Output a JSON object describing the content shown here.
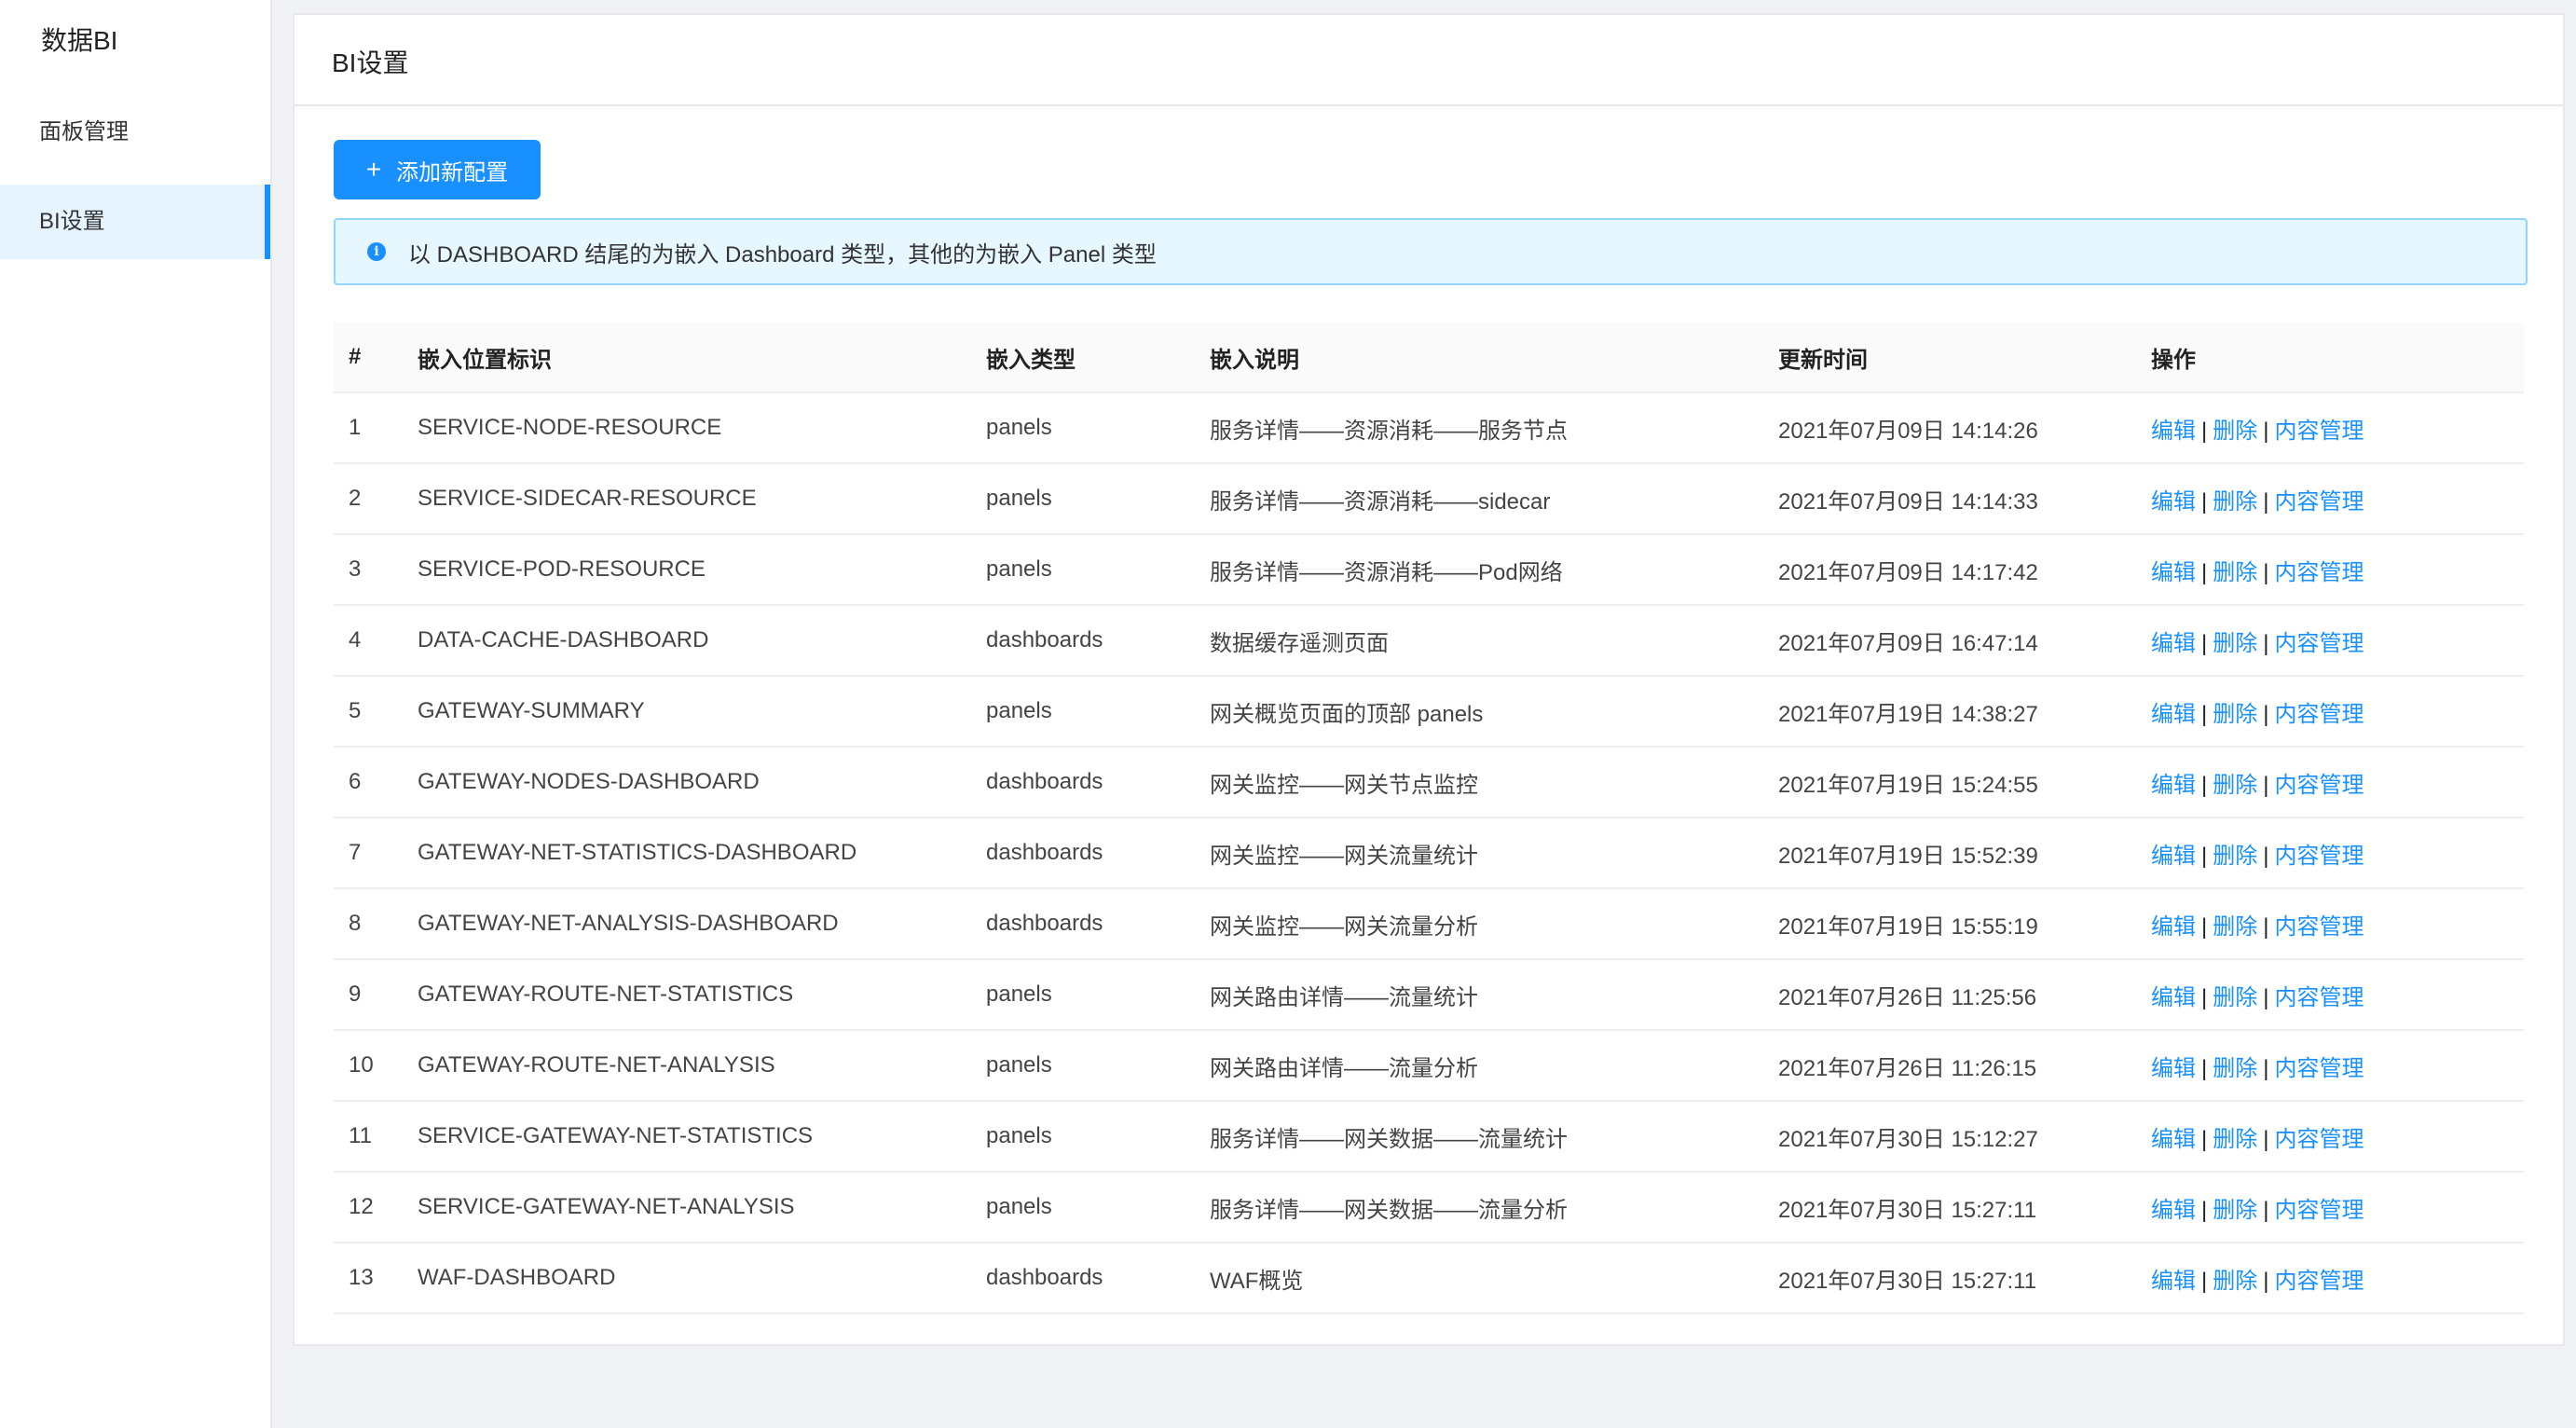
{
  "sidebar": {
    "title": "数据BI",
    "items": [
      {
        "label": "面板管理"
      },
      {
        "label": "BI设置"
      }
    ]
  },
  "page": {
    "title": "BI设置",
    "add_button_label": "添加新配置",
    "alert_text": "以 DASHBOARD 结尾的为嵌入 Dashboard 类型，其他的为嵌入 Panel 类型"
  },
  "table": {
    "headers": {
      "num": "#",
      "id": "嵌入位置标识",
      "type": "嵌入类型",
      "desc": "嵌入说明",
      "time": "更新时间",
      "ops": "操作"
    },
    "actions": {
      "edit": "编辑",
      "delete": "删除",
      "content": "内容管理",
      "separator": "|"
    },
    "rows": [
      {
        "num": "1",
        "id": "SERVICE-NODE-RESOURCE",
        "type": "panels",
        "desc": "服务详情——资源消耗——服务节点",
        "time": "2021年07月09日 14:14:26"
      },
      {
        "num": "2",
        "id": "SERVICE-SIDECAR-RESOURCE",
        "type": "panels",
        "desc": "服务详情——资源消耗——sidecar",
        "time": "2021年07月09日 14:14:33"
      },
      {
        "num": "3",
        "id": "SERVICE-POD-RESOURCE",
        "type": "panels",
        "desc": "服务详情——资源消耗——Pod网络",
        "time": "2021年07月09日 14:17:42"
      },
      {
        "num": "4",
        "id": "DATA-CACHE-DASHBOARD",
        "type": "dashboards",
        "desc": "数据缓存遥测页面",
        "time": "2021年07月09日 16:47:14"
      },
      {
        "num": "5",
        "id": "GATEWAY-SUMMARY",
        "type": "panels",
        "desc": "网关概览页面的顶部 panels",
        "time": "2021年07月19日 14:38:27"
      },
      {
        "num": "6",
        "id": "GATEWAY-NODES-DASHBOARD",
        "type": "dashboards",
        "desc": "网关监控——网关节点监控",
        "time": "2021年07月19日 15:24:55"
      },
      {
        "num": "7",
        "id": "GATEWAY-NET-STATISTICS-DASHBOARD",
        "type": "dashboards",
        "desc": "网关监控——网关流量统计",
        "time": "2021年07月19日 15:52:39"
      },
      {
        "num": "8",
        "id": "GATEWAY-NET-ANALYSIS-DASHBOARD",
        "type": "dashboards",
        "desc": "网关监控——网关流量分析",
        "time": "2021年07月19日 15:55:19"
      },
      {
        "num": "9",
        "id": "GATEWAY-ROUTE-NET-STATISTICS",
        "type": "panels",
        "desc": "网关路由详情——流量统计",
        "time": "2021年07月26日 11:25:56"
      },
      {
        "num": "10",
        "id": "GATEWAY-ROUTE-NET-ANALYSIS",
        "type": "panels",
        "desc": "网关路由详情——流量分析",
        "time": "2021年07月26日 11:26:15"
      },
      {
        "num": "11",
        "id": "SERVICE-GATEWAY-NET-STATISTICS",
        "type": "panels",
        "desc": "服务详情——网关数据——流量统计",
        "time": "2021年07月30日 15:12:27"
      },
      {
        "num": "12",
        "id": "SERVICE-GATEWAY-NET-ANALYSIS",
        "type": "panels",
        "desc": "服务详情——网关数据——流量分析",
        "time": "2021年07月30日 15:27:11"
      },
      {
        "num": "13",
        "id": "WAF-DASHBOARD",
        "type": "dashboards",
        "desc": "WAF概览",
        "time": "2021年07月30日 15:27:11"
      }
    ]
  },
  "colors": {
    "accent": "#1890ff",
    "active_bg": "#e6f4ff",
    "alert_bg": "#e6f7ff",
    "alert_border": "#91d5ff"
  }
}
